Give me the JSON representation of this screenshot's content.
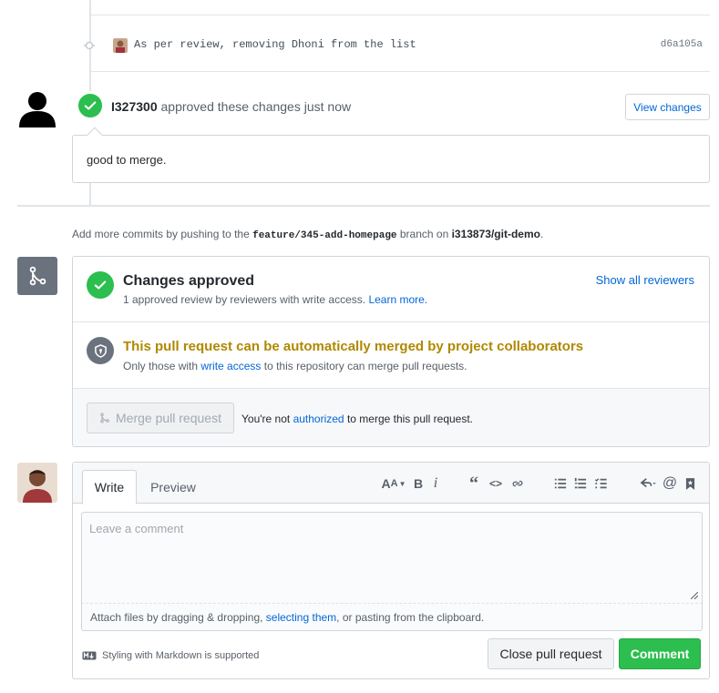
{
  "colors": {
    "success": "#2cbe4e",
    "warning": "#b08800",
    "link": "#0366d6",
    "neutral": "#6a737d"
  },
  "commit": {
    "message": "As per review, removing Dhoni from the list",
    "sha": "d6a105a"
  },
  "review": {
    "reviewer": "I327300",
    "action": "approved these changes just now",
    "view_changes_label": "View changes",
    "body": "good to merge."
  },
  "push_hint": {
    "prefix": "Add more commits by pushing to the ",
    "branch": "feature/345-add-homepage",
    "middle": " branch on ",
    "repo": "i313873/git-demo",
    "suffix": "."
  },
  "merge_status": {
    "approved_title": "Changes approved",
    "approved_sub": "1 approved review by reviewers with write access. ",
    "learn_more": "Learn more.",
    "show_reviewers": "Show all reviewers",
    "collab_title": "This pull request can be automatically merged by project collaborators",
    "collab_sub_prefix": "Only those with ",
    "write_access": "write access",
    "collab_sub_suffix": " to this repository can merge pull requests.",
    "merge_button": "Merge pull request",
    "not_auth_prefix": "You're not ",
    "authorized": "authorized",
    "not_auth_suffix": " to merge this pull request."
  },
  "comment": {
    "tabs": [
      "Write",
      "Preview"
    ],
    "toolbar_icons": [
      "text-size-icon",
      "bold-icon",
      "italic-icon",
      "quote-icon",
      "code-icon",
      "link-icon",
      "unordered-list-icon",
      "ordered-list-icon",
      "task-list-icon",
      "reply-icon",
      "mention-icon",
      "bookmark-icon"
    ],
    "placeholder": "Leave a comment",
    "attach_prefix": "Attach files by dragging & dropping, ",
    "attach_link": "selecting them",
    "attach_suffix": ", or pasting from the clipboard.",
    "markdown_note": "Styling with Markdown is supported",
    "close_button": "Close pull request",
    "comment_button": "Comment"
  }
}
